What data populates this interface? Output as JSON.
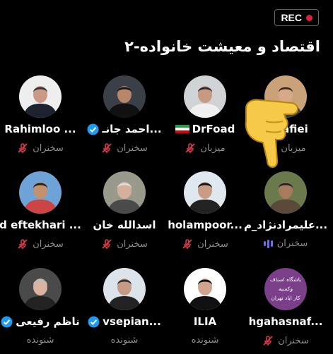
{
  "recording": {
    "label": "REC",
    "color": "#e0203a"
  },
  "room": {
    "title": "اقتصاد و معیشت خانواده-۲"
  },
  "colors": {
    "mic_muted": "#d93a4a",
    "role_text": "#8d8d8d",
    "verified": "#1d9bf0",
    "speaking_wave": "#6a6ff0"
  },
  "participants": [
    {
      "name": "a Rafiei",
      "role": "میزبان",
      "mic": "muted"
    },
    {
      "name": "DrFoad",
      "role": "میزبان",
      "mic": "muted",
      "flag": "iran"
    },
    {
      "name": "احمد جانـ...",
      "role": "سخنران",
      "mic": "muted",
      "verified": true
    },
    {
      "name": "Rahimloo ...",
      "role": "سخنران",
      "mic": "muted"
    },
    {
      "name": "علیمرادنژاد_م...",
      "role": "سخنران",
      "mic": "speaking"
    },
    {
      "name": "holampoor...",
      "role": "سخنران",
      "mic": "muted"
    },
    {
      "name": "اسدالله خان",
      "role": "سخنران",
      "mic": "muted"
    },
    {
      "name": "d eftekhari ...",
      "role": "سخنران",
      "mic": "muted"
    },
    {
      "name": "hgahasnaf...",
      "role": "سخنران",
      "mic": "muted",
      "avatar_text": [
        "باشگاه اصناف",
        "وکسبه",
        "کار ایاد تهران"
      ]
    },
    {
      "name": "ILIA",
      "role": "شنونده",
      "mic": "none"
    },
    {
      "name": "vsepian...",
      "role": "شنونده",
      "mic": "none",
      "verified": true
    },
    {
      "name": "ناظم رفیعی",
      "role": "شنونده",
      "mic": "none",
      "verified": true
    }
  ]
}
